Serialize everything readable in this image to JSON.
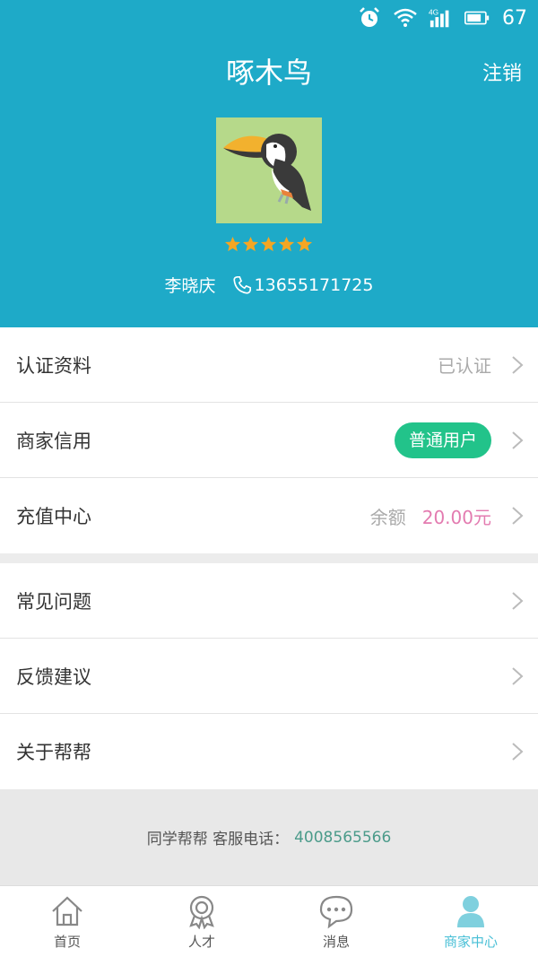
{
  "status_bar": {
    "battery": "67",
    "network": "4G"
  },
  "header": {
    "title": "啄木鸟",
    "logout_label": "注销"
  },
  "profile": {
    "name": "李晓庆",
    "phone": "13655171725",
    "rating": 5
  },
  "group1": [
    {
      "label": "认证资料",
      "value": "已认证"
    },
    {
      "label": "商家信用",
      "badge": "普通用户"
    },
    {
      "label": "充值中心",
      "balance_label": "余额",
      "balance_value": "20.00元"
    }
  ],
  "group2": [
    {
      "label": "常见问题"
    },
    {
      "label": "反馈建议"
    },
    {
      "label": "关于帮帮"
    }
  ],
  "footer": {
    "text": "同学帮帮 客服电话：",
    "phone": "4008565566"
  },
  "tabs": [
    {
      "label": "首页",
      "icon": "home-icon"
    },
    {
      "label": "人才",
      "icon": "badge-icon"
    },
    {
      "label": "消息",
      "icon": "chat-icon"
    },
    {
      "label": "商家中心",
      "icon": "person-icon",
      "active": true
    }
  ],
  "colors": {
    "header": "#1eaac8",
    "badge": "#22c38a",
    "balance": "#e37bb0",
    "active_tab": "#48bfd6"
  }
}
